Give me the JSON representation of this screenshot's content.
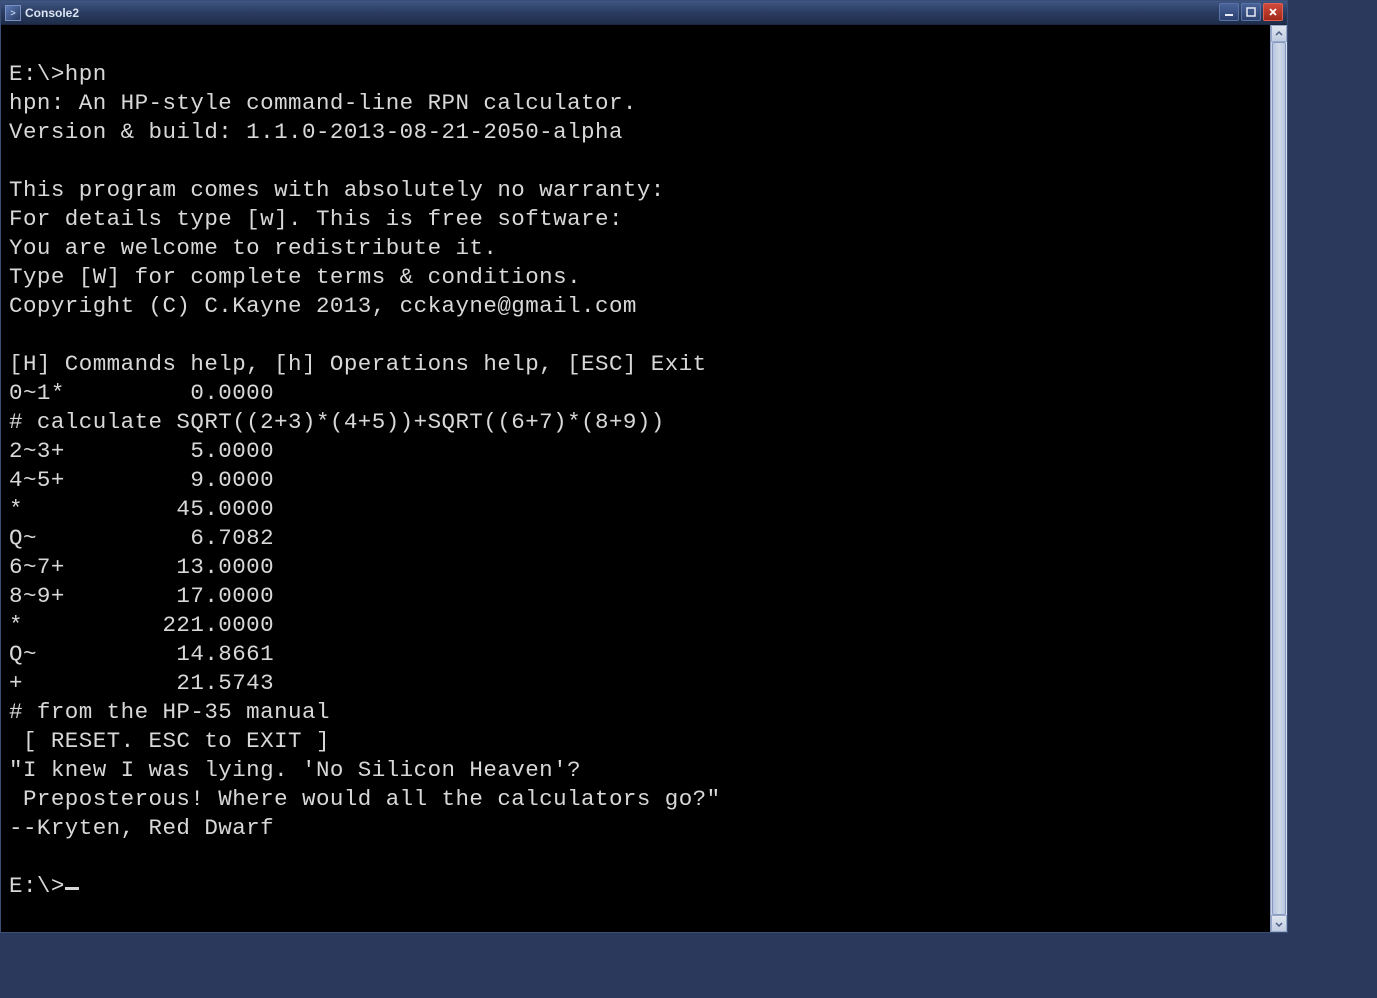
{
  "window": {
    "title": "Console2"
  },
  "terminal": {
    "lines": [
      "",
      "E:\\>hpn",
      "hpn: An HP-style command-line RPN calculator.",
      "Version & build: 1.1.0-2013-08-21-2050-alpha",
      "",
      "This program comes with absolutely no warranty:",
      "For details type [w]. This is free software:",
      "You are welcome to redistribute it.",
      "Type [W] for complete terms & conditions.",
      "Copyright (C) C.Kayne 2013, cckayne@gmail.com",
      "",
      "[H] Commands help, [h] Operations help, [ESC] Exit",
      "0~1*         0.0000",
      "# calculate SQRT((2+3)*(4+5))+SQRT((6+7)*(8+9))",
      "2~3+         5.0000",
      "4~5+         9.0000",
      "*           45.0000",
      "Q~           6.7082",
      "6~7+        13.0000",
      "8~9+        17.0000",
      "*          221.0000",
      "Q~          14.8661",
      "+           21.5743",
      "# from the HP-35 manual",
      " [ RESET. ESC to EXIT ]",
      "\"I knew I was lying. 'No Silicon Heaven'?",
      " Preposterous! Where would all the calculators go?\"",
      "--Kryten, Red Dwarf",
      "",
      "E:\\>"
    ]
  }
}
